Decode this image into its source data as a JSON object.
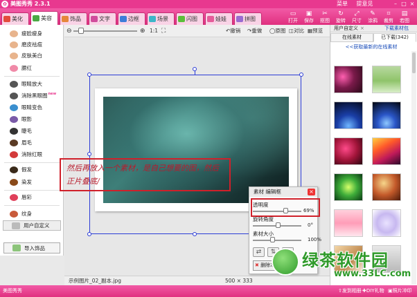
{
  "app": {
    "title": "美图秀秀 2.3.1",
    "icon": "meitu-logo-icon"
  },
  "window_menu": {
    "items": [
      "菜单",
      "提意见"
    ],
    "min": "–",
    "max": "□",
    "close": "×"
  },
  "tabs": [
    {
      "label": "美化",
      "icon": "beautify-icon",
      "color": "#e44b3c",
      "active": false
    },
    {
      "label": "美容",
      "icon": "cosmetic-icon",
      "color": "#4aa844",
      "active": true,
      "badge": "new"
    },
    {
      "label": "饰品",
      "icon": "accessory-icon",
      "color": "#e6873a",
      "active": false
    },
    {
      "label": "文字",
      "icon": "text-icon",
      "color": "#d04c9c",
      "active": false
    },
    {
      "label": "边框",
      "icon": "frame-icon",
      "color": "#3d7dd8",
      "active": false
    },
    {
      "label": "场景",
      "icon": "scene-icon",
      "color": "#3db6c8",
      "active": false
    },
    {
      "label": "闪图",
      "icon": "flash-icon",
      "color": "#5bbf3a",
      "active": false
    },
    {
      "label": "娃娃",
      "icon": "doll-icon",
      "color": "#e55c9a",
      "active": false
    },
    {
      "label": "拼图",
      "icon": "puzzle-icon",
      "color": "#9a6bd1",
      "active": false
    }
  ],
  "toolbar": [
    {
      "label": "打开",
      "icon": "open-folder-icon",
      "glyph": "▭"
    },
    {
      "label": "保存",
      "icon": "save-icon",
      "glyph": "▣"
    },
    {
      "label": "抠图",
      "icon": "cutout-icon",
      "glyph": "✂"
    },
    {
      "label": "旋转",
      "icon": "rotate-icon",
      "glyph": "↻"
    },
    {
      "label": "尺寸",
      "icon": "resize-icon",
      "glyph": "⤢"
    },
    {
      "label": "涂鸦",
      "icon": "doodle-icon",
      "glyph": "✎"
    },
    {
      "label": "裁剪",
      "icon": "crop-icon",
      "glyph": "⌗"
    },
    {
      "label": "若图",
      "icon": "picture-icon",
      "glyph": "▤"
    }
  ],
  "left_menu": [
    {
      "label": "瘦脸瘦身",
      "icon": "slim-face-icon",
      "color": "#e8b48d"
    },
    {
      "label": "磨皮祛痘",
      "icon": "smooth-skin-icon",
      "color": "#e8b48d"
    },
    {
      "label": "皮肤美白",
      "icon": "whiten-skin-icon",
      "color": "#e8b48d"
    },
    {
      "label": "腮红",
      "icon": "blush-icon",
      "color": "#f08aa8"
    },
    {
      "label": "眼睛放大",
      "icon": "enlarge-eyes-icon",
      "color": "#555555"
    },
    {
      "label": "消除黑眼圈",
      "icon": "dark-circles-icon",
      "color": "#555555",
      "badge": "new"
    },
    {
      "label": "眼睛变色",
      "icon": "eye-color-icon",
      "color": "#3a8fcf"
    },
    {
      "label": "眼影",
      "icon": "eyeshadow-icon",
      "color": "#7a5aa8"
    },
    {
      "label": "睫毛",
      "icon": "eyelash-icon",
      "color": "#333333"
    },
    {
      "label": "眉毛",
      "icon": "eyebrow-icon",
      "color": "#5a3a24"
    },
    {
      "label": "消除红眼",
      "icon": "red-eye-icon",
      "color": "#d33a3a"
    },
    {
      "label": "假发",
      "icon": "wig-icon",
      "color": "#3a2a1a"
    },
    {
      "label": "染发",
      "icon": "hair-dye-icon",
      "color": "#8a4a1a"
    },
    {
      "label": "唇彩",
      "icon": "lip-color-icon",
      "color": "#e0405a"
    },
    {
      "label": "纹身",
      "icon": "tattoo-icon",
      "color": "#c85a3a"
    },
    {
      "label": "用户自定义",
      "icon": "user-custom-icon",
      "color": "#bbbbbb"
    }
  ],
  "import_button": {
    "label": "导入饰品",
    "icon": "import-icon"
  },
  "canvas_header": {
    "zoom_out": "⊖",
    "zoom_in": "⊕",
    "actual_size": "1:1",
    "fit": "⛶",
    "undo": "撤销",
    "redo": "重做",
    "original": "原图",
    "compare": "对比",
    "preview": "预览"
  },
  "annotation": {
    "text": "然后再放入一个素材，是自己想要的图，然后正片叠底/"
  },
  "status": {
    "filename": "示例图片_02_副本.jpg",
    "dimensions": "500 × 333"
  },
  "material_panel": {
    "title": "素材 编辑框",
    "opacity_label": "透明度",
    "opacity_value": "69%",
    "opacity_fraction": 0.69,
    "rotation_label": "旋转角度",
    "rotation_value": "0°",
    "rotation_fraction": 0.5,
    "size_label": "素材大小",
    "size_value": "100%",
    "size_fraction": 0.38,
    "delete_label": "删除本素材",
    "buttons": [
      {
        "icon": "flip-horizontal-icon",
        "glyph": "⇄"
      },
      {
        "icon": "flip-vertical-icon",
        "glyph": "⇅"
      },
      {
        "icon": "copy-icon",
        "glyph": "⧉"
      }
    ]
  },
  "right_panel": {
    "tab": "用户自定义",
    "tab_close": "×",
    "download_link": "下载素材包",
    "subtabs": [
      "在线素材",
      "已下载(342)"
    ],
    "online_link": "<<获取最新的在线素材",
    "thumbnails": [
      "radial-gradient(circle at 30% 40%, #ff5fb0 0%, #7a1a4a 45%, #2a0a18 100%)",
      "linear-gradient(180deg, #b8d9a0 0%, #8fc46a 55%, #d9eec8 100%)",
      "radial-gradient(circle at 50% 90%, #6fb6ff 0%, #1a3fa8 40%, #050a20 100%)",
      "radial-gradient(circle at 50% 80%, #8ec8ff 0%, #2a56c8 35%, #02060f 100%)",
      "radial-gradient(circle at 40% 40%, #ff4a8a 0%, #a3153a 50%, #2a0510 100%)",
      "linear-gradient(150deg, #ffd040 0%, #ff5a2a 35%, #c01a5a 65%, #2a0a2a 100%)",
      "radial-gradient(circle at 50% 50%, #d6ff6a 0%, #3fae3a 45%, #0a3a14 100%)",
      "radial-gradient(circle at 40% 35%, #f6d58a 0%, #c45a2a 50%, #4a1a0a 100%)",
      "linear-gradient(180deg, #ffd0dc 0%, #ff9db8 50%, #ffe6ee 100%)",
      "radial-gradient(circle at 50% 50%, #e9e2ff 0%, #c7b8f0 50%, #ffffff 100%)",
      "linear-gradient(135deg, #f4d7a8 0%, #c08a50 60%, #f8efe0 100%)",
      "linear-gradient(180deg, #e8e8e8 0%, #b8b8b8 100%)"
    ]
  },
  "bottom_bar": {
    "items": [
      {
        "label": "美图秀秀",
        "icon": "logo-small-icon"
      },
      {
        "label": "发到相册",
        "icon": "upload-album-icon"
      },
      {
        "label": "DIY礼物",
        "icon": "gift-icon"
      },
      {
        "label": "照片冲印",
        "icon": "print-icon"
      }
    ]
  },
  "watermark": {
    "brand": "绿茶软件园",
    "url": "www.33LC.com",
    "logo": "greentea-logo-icon"
  }
}
